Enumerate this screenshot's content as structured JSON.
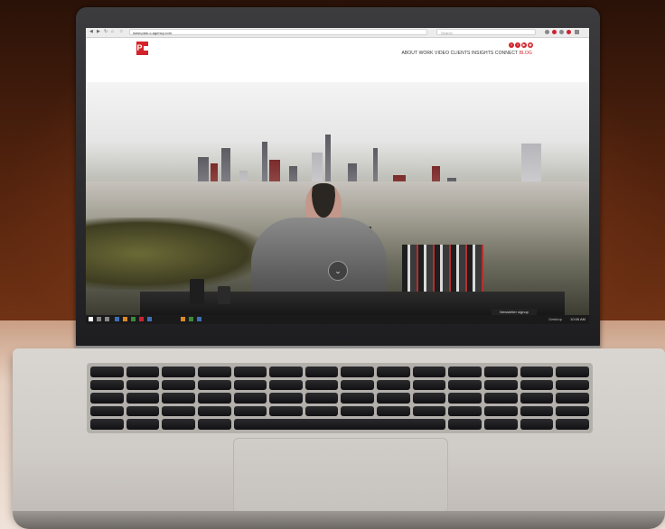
{
  "browser": {
    "url": "www.plan-c-agency.com",
    "search_placeholder": "Search"
  },
  "site": {
    "logo_text": "P",
    "nav_items": [
      "ABOUT",
      "WORK",
      "VIDEO",
      "CLIENTS",
      "INSIGHTS",
      "CONNECT",
      "BLOG"
    ],
    "social_icons": [
      "facebook-icon",
      "twitter-icon",
      "youtube-icon",
      "instagram-icon"
    ],
    "newsletter_label": "Newsletter signup",
    "brand_color": "#d2232a"
  },
  "taskbar": {
    "tray_label": "Desktop",
    "clock": "10:06 AM"
  }
}
